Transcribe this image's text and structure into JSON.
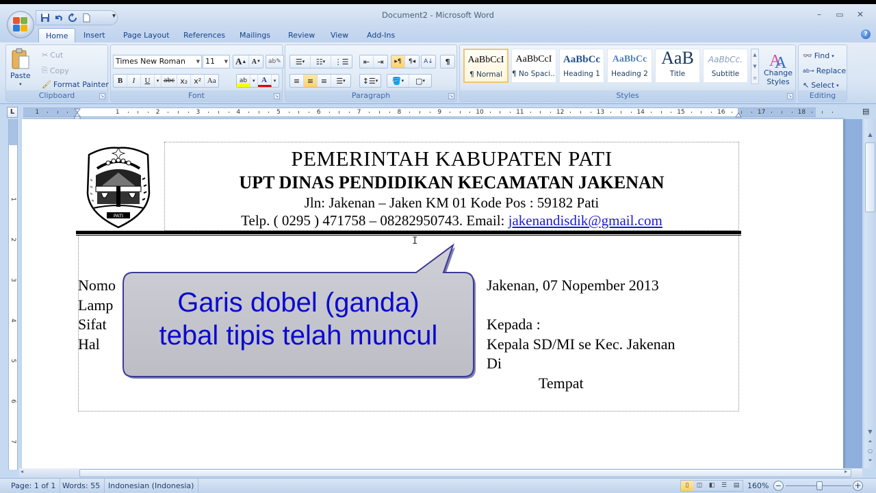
{
  "window": {
    "title": "Document2 - Microsoft Word",
    "controls": {
      "minimize": "–",
      "maximize": "▭",
      "close": "✕"
    }
  },
  "quick_access": {
    "more": "▾"
  },
  "tabs": [
    {
      "label": "Home",
      "active": true
    },
    {
      "label": "Insert"
    },
    {
      "label": "Page Layout"
    },
    {
      "label": "References"
    },
    {
      "label": "Mailings"
    },
    {
      "label": "Review"
    },
    {
      "label": "View"
    },
    {
      "label": "Add-Ins"
    }
  ],
  "help": "?",
  "ribbon": {
    "clipboard": {
      "label": "Clipboard",
      "paste": "Paste",
      "cut": "Cut",
      "copy": "Copy",
      "format_painter": "Format Painter"
    },
    "font": {
      "label": "Font",
      "font_name": "Times New Roman",
      "font_size": "11",
      "grow": "A",
      "shrink": "A",
      "bold": "B",
      "italic": "I",
      "underline": "U",
      "strike": "abc",
      "subscript": "x₂",
      "superscript": "x²",
      "change_case": "Aa",
      "highlight": "ab",
      "font_color": "A"
    },
    "paragraph": {
      "label": "Paragraph",
      "show_marks": "¶",
      "sort": "A↓"
    },
    "styles": {
      "label": "Styles",
      "items": [
        {
          "sample": "AaBbCcI",
          "name": "¶ Normal",
          "selected": true
        },
        {
          "sample": "AaBbCcI",
          "name": "¶ No Spaci..."
        },
        {
          "sample": "AaBbCc",
          "name": "Heading 1"
        },
        {
          "sample": "AaBbCc",
          "name": "Heading 2"
        },
        {
          "sample": "AaB",
          "name": "Title"
        },
        {
          "sample": "AaBbCc.",
          "name": "Subtitle"
        }
      ],
      "change_styles": "Change Styles"
    },
    "editing": {
      "label": "Editing",
      "find": "Find",
      "replace": "Replace",
      "select": "Select"
    }
  },
  "ruler": {
    "corner": "L",
    "numbers": [
      "1",
      "1",
      "2",
      "3",
      "4",
      "5",
      "6",
      "7",
      "8",
      "9",
      "10",
      "11",
      "12",
      "13",
      "14",
      "15",
      "16",
      "17",
      "18"
    ],
    "vertical_numbers": [
      "1",
      "2",
      "3",
      "4",
      "5",
      "6",
      "7"
    ]
  },
  "document": {
    "kop": {
      "line1": "PEMERINTAH KABUPATEN PATI",
      "line2": "UPT  DINAS PENDIDIKAN KECAMATAN JAKENAN",
      "line3": "Jln:  Jakenan – Jaken KM 01  Kode Pos : 59182 Pati",
      "line4_prefix": "Telp. ( 0295 ) 471758 – 08282950743. Email: ",
      "email": "jakenandisdik@gmail.com",
      "logo_label": "PATI"
    },
    "left_fields": [
      "Nomo",
      "Lamp",
      "Sifat",
      "Hal"
    ],
    "date": "Jakenan, 07 Nopember  2013",
    "kepada": "Kepada :",
    "recipient": "Kepala SD/MI se Kec. Jakenan",
    "di": "Di",
    "tempat": "Tempat"
  },
  "callout": {
    "line1": "Garis dobel (ganda)",
    "line2": "tebal tipis telah muncul",
    "text_color": "#0a0ad0",
    "fill_color": "#c4c4cc",
    "border_color": "#3a3a9a"
  },
  "statusbar": {
    "page": "Page: 1 of 1",
    "words": "Words: 55",
    "language": "Indonesian (Indonesia)",
    "zoom": "160%",
    "zoom_out": "−",
    "zoom_in": "+"
  }
}
